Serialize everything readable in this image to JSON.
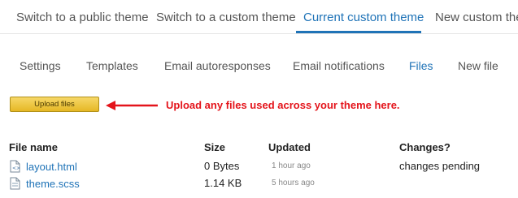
{
  "top_tabs": [
    {
      "label": "Switch to a public theme"
    },
    {
      "label": "Switch to a custom theme"
    },
    {
      "label": "Current custom theme"
    },
    {
      "label": "New custom ther"
    }
  ],
  "sub_tabs": [
    {
      "label": "Settings"
    },
    {
      "label": "Templates"
    },
    {
      "label": "Email autoresponses"
    },
    {
      "label": "Email notifications"
    },
    {
      "label": "Files"
    },
    {
      "label": "New file"
    }
  ],
  "upload": {
    "button_label": "Upload files",
    "annotation": "Upload any files used across your theme here."
  },
  "file_table": {
    "headers": {
      "file_name": "File name",
      "size": "Size",
      "updated": "Updated",
      "changes": "Changes?"
    },
    "rows": [
      {
        "name": "layout.html",
        "size": "0 Bytes",
        "updated": "1 hour ago",
        "changes": "changes pending"
      },
      {
        "name": "theme.scss",
        "size": "1.14 KB",
        "updated": "5 hours ago",
        "changes": ""
      }
    ]
  },
  "colors": {
    "accent": "#1f73b7",
    "annotation_red": "#e4141b",
    "upload_button": "#f0c94a"
  },
  "icons": {
    "file": "file-icon",
    "arrow": "left-arrow-icon"
  }
}
